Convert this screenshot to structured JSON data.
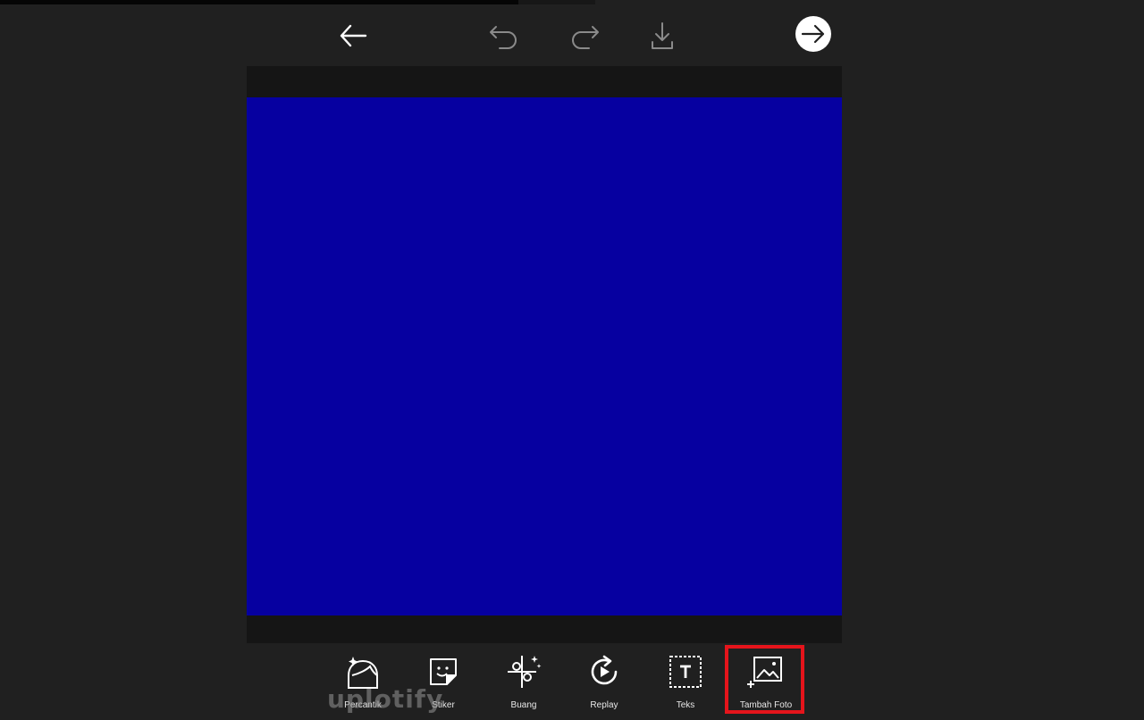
{
  "toolbar": {
    "items": [
      {
        "label": "Percantik",
        "icon": "face-sparkle-icon"
      },
      {
        "label": "Stiker",
        "icon": "sticker-icon"
      },
      {
        "label": "Buang",
        "icon": "scissors-icon"
      },
      {
        "label": "Replay",
        "icon": "replay-icon"
      },
      {
        "label": "Teks",
        "icon": "text-icon"
      },
      {
        "label": "Tambah Foto",
        "icon": "add-photo-icon"
      },
      {
        "label": "",
        "icon": "pattern-icon"
      }
    ],
    "highlighted": "Tambah Foto",
    "highlight_color": "#e5141b"
  },
  "canvas": {
    "color": "#0600a0"
  },
  "watermark": "uplotify"
}
